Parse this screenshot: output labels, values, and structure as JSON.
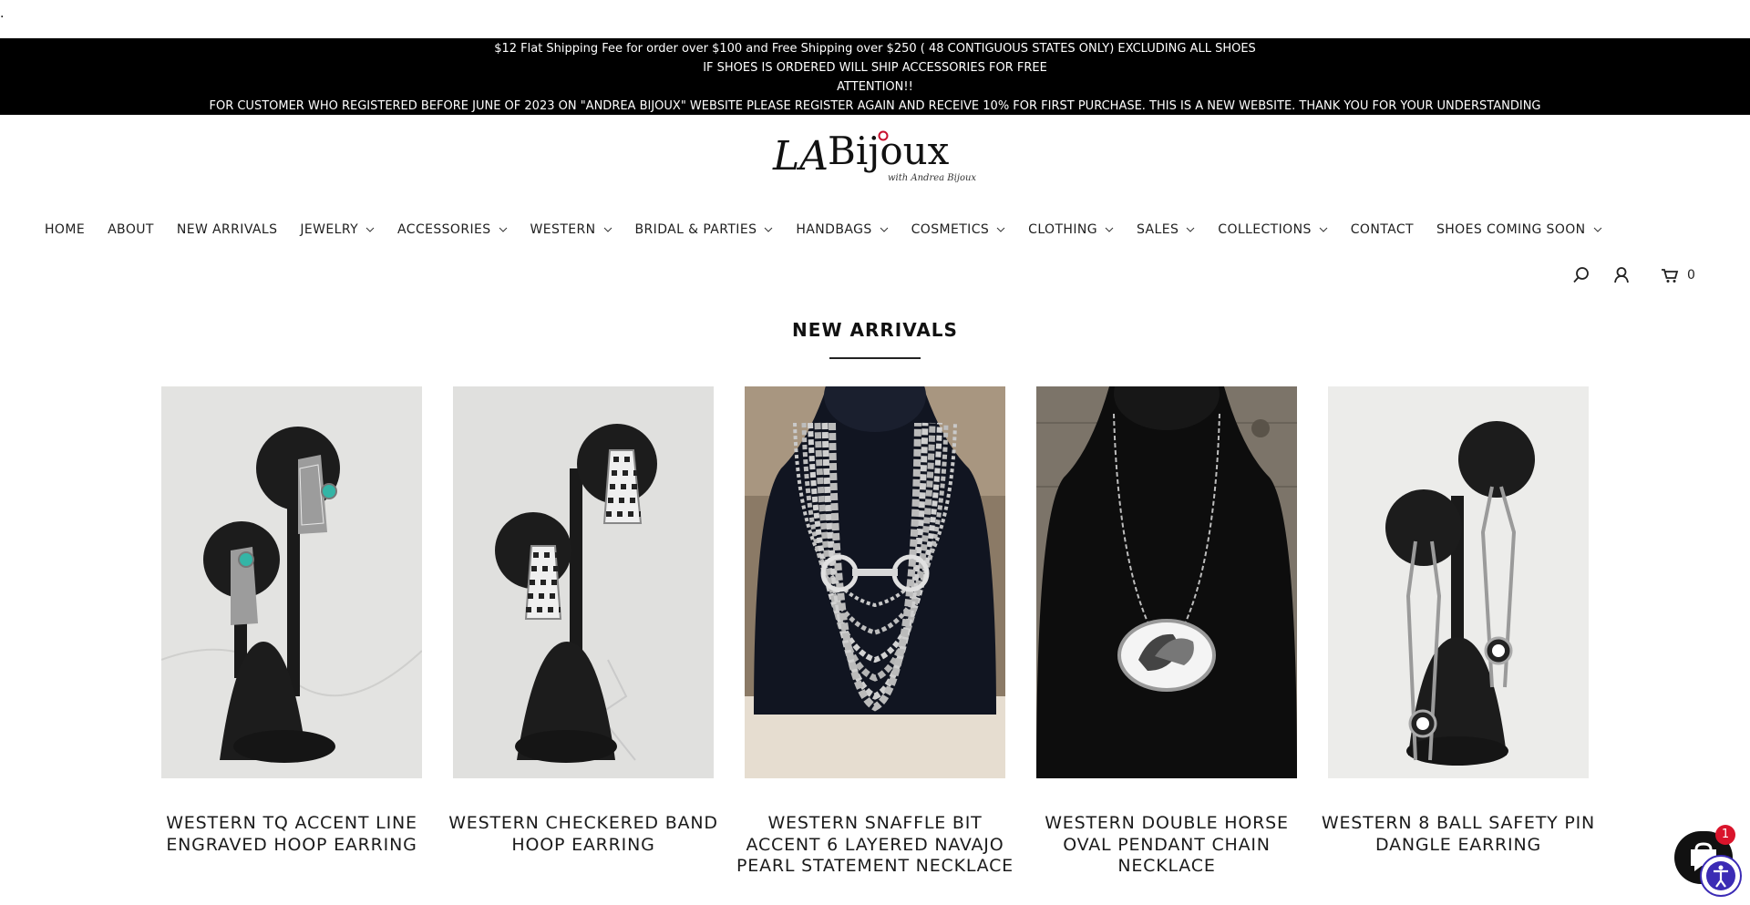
{
  "top_marker": ".",
  "announcement": {
    "line1": "$12 Flat Shipping Fee for order over $100 and Free Shipping over $250 ( 48 CONTIGUOUS STATES ONLY) EXCLUDING ALL SHOES",
    "line2": "IF SHOES IS ORDERED WILL SHIP ACCESSORIES FOR FREE",
    "line3": "ATTENTION!!",
    "line4": "FOR CUSTOMER WHO REGISTERED BEFORE JUNE OF 2023 ON \"ANDREA BIJOUX\" WEBSITE PLEASE REGISTER AGAIN AND RECEIVE 10% FOR FIRST PURCHASE. THIS IS A NEW WEBSITE. THANK YOU FOR YOUR UNDERSTANDING"
  },
  "logo": {
    "text": "LA Bijoux",
    "subtext": "with Andrea Bijoux"
  },
  "nav": [
    {
      "label": "HOME",
      "dropdown": false
    },
    {
      "label": "ABOUT",
      "dropdown": false
    },
    {
      "label": "NEW ARRIVALS",
      "dropdown": false
    },
    {
      "label": "JEWELRY",
      "dropdown": true
    },
    {
      "label": "ACCESSORIES",
      "dropdown": true
    },
    {
      "label": "WESTERN",
      "dropdown": true
    },
    {
      "label": "BRIDAL & PARTIES",
      "dropdown": true
    },
    {
      "label": "HANDBAGS",
      "dropdown": true
    },
    {
      "label": "COSMETICS",
      "dropdown": true
    },
    {
      "label": "CLOTHING",
      "dropdown": true
    },
    {
      "label": "SALES",
      "dropdown": true
    },
    {
      "label": "COLLECTIONS",
      "dropdown": true
    },
    {
      "label": "CONTACT",
      "dropdown": false
    },
    {
      "label": "SHOES COMING SOON",
      "dropdown": true
    }
  ],
  "utility": {
    "search_icon": "search-icon",
    "account_icon": "account-icon",
    "cart_icon": "cart-icon",
    "cart_count": "0"
  },
  "section": {
    "title": "NEW ARRIVALS"
  },
  "products": [
    {
      "title": "WESTERN TQ ACCENT LINE ENGRAVED HOOP EARRING",
      "image": "earrings-turquoise"
    },
    {
      "title": "WESTERN CHECKERED BAND HOOP EARRING",
      "image": "earrings-checkered"
    },
    {
      "title": "WESTERN SNAFFLE BIT ACCENT 6 LAYERED NAVAJO PEARL STATEMENT NECKLACE",
      "image": "necklace-layered-pearl"
    },
    {
      "title": "WESTERN DOUBLE HORSE OVAL PENDANT CHAIN NECKLACE",
      "image": "necklace-horse-pendant"
    },
    {
      "title": "WESTERN 8 BALL SAFETY PIN DANGLE EARRING",
      "image": "earrings-8-ball"
    }
  ],
  "chat": {
    "badge_count": "1",
    "icon": "chat-icon"
  },
  "accessibility": {
    "icon": "accessibility-icon"
  },
  "colors": {
    "announcement_bg": "#000000",
    "text": "#1e1e1e",
    "badge": "#d9142b",
    "accessibility": "#3b2bb5"
  }
}
